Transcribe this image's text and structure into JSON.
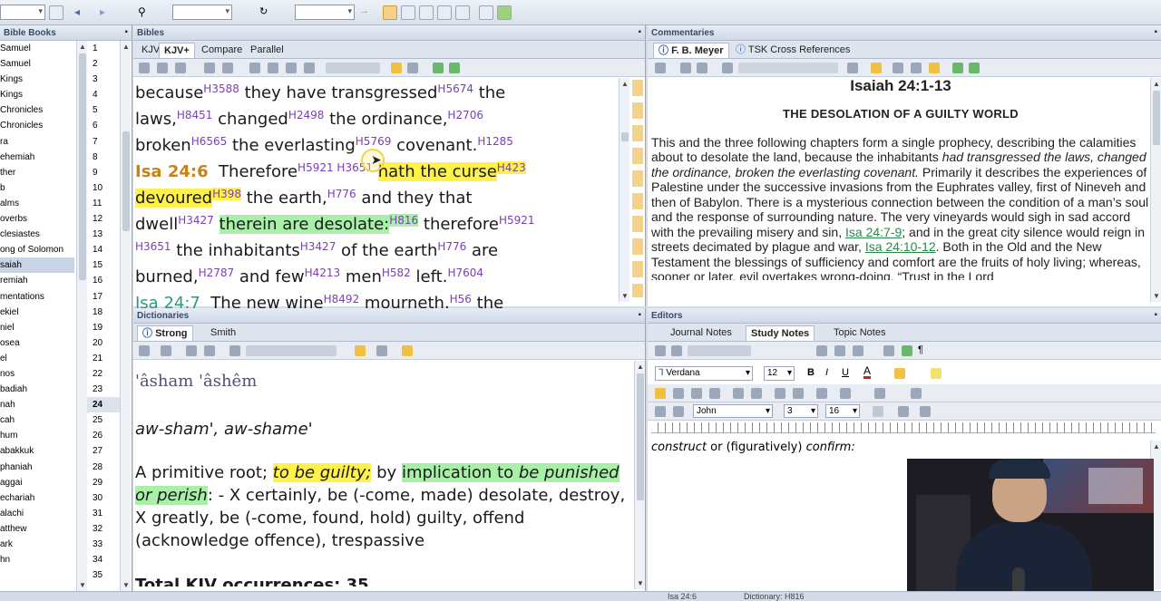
{
  "books_panel": {
    "title": "Bible Books",
    "books": [
      "Samuel",
      "Samuel",
      "Kings",
      "Kings",
      "Chronicles",
      "Chronicles",
      "ra",
      "ehemiah",
      "ther",
      "b",
      "alms",
      "overbs",
      "clesiastes",
      "ong of Solomon",
      "saiah",
      "remiah",
      "mentations",
      "ekiel",
      "niel",
      "osea",
      "el",
      "nos",
      "badiah",
      "nah",
      "cah",
      "hum",
      "abakkuk",
      "phaniah",
      "aggai",
      "echariah",
      "alachi",
      "atthew",
      "ark",
      "hn"
    ],
    "selected_book_index": 14,
    "chapters": [
      "1",
      "2",
      "3",
      "4",
      "5",
      "6",
      "7",
      "8",
      "9",
      "10",
      "11",
      "12",
      "13",
      "14",
      "15",
      "16",
      "17",
      "18",
      "19",
      "20",
      "21",
      "22",
      "23",
      "24",
      "25",
      "26",
      "27",
      "28",
      "29",
      "30",
      "31",
      "32",
      "33",
      "34",
      "35"
    ],
    "selected_chapter_index": 23
  },
  "bibles_panel": {
    "title": "Bibles",
    "tabs": [
      "KJV",
      "KJV+",
      "Compare",
      "Parallel"
    ],
    "active_tab": "KJV+",
    "lines": [
      [
        {
          "t": "because"
        },
        {
          "s": "H3588"
        },
        {
          "t": " they have transgressed"
        },
        {
          "s": "H5674"
        },
        {
          "t": " the"
        }
      ],
      [
        {
          "t": "laws,"
        },
        {
          "s": "H8451"
        },
        {
          "t": " changed"
        },
        {
          "s": "H2498"
        },
        {
          "t": " the ordinance,"
        },
        {
          "s": "H2706"
        }
      ],
      [
        {
          "t": "broken"
        },
        {
          "s": "H6565"
        },
        {
          "t": " the everlasting"
        },
        {
          "s": "H5769"
        },
        {
          "t": " covenant."
        },
        {
          "s": "H1285"
        }
      ],
      [
        {
          "v": "Isa 24:6"
        },
        {
          "t": "  Therefore"
        },
        {
          "s": "H5921"
        },
        {
          "s": " H3651"
        },
        {
          "t": " "
        },
        {
          "y": "hath the curse"
        },
        {
          "sy": "H423"
        }
      ],
      [
        {
          "y": "devoured"
        },
        {
          "sy": "H398"
        },
        {
          "t": " the earth,"
        },
        {
          "s": "H776"
        },
        {
          "t": " and they that"
        }
      ],
      [
        {
          "t": "dwell"
        },
        {
          "s": "H3427"
        },
        {
          "t": " "
        },
        {
          "g": "therein are desolate:"
        },
        {
          "sg": "H816"
        },
        {
          "t": " therefore"
        },
        {
          "s": "H5921"
        }
      ],
      [
        {
          "s": "H3651"
        },
        {
          "t": " the inhabitants"
        },
        {
          "s": "H3427"
        },
        {
          "t": " of the earth"
        },
        {
          "s": "H776"
        },
        {
          "t": " are"
        }
      ],
      [
        {
          "t": "burned,"
        },
        {
          "s": "H2787"
        },
        {
          "t": " and few"
        },
        {
          "s": "H4213"
        },
        {
          "t": " men"
        },
        {
          "s": "H582"
        },
        {
          "t": " left."
        },
        {
          "s": "H7604"
        }
      ],
      [
        {
          "v2": "Isa 24:7"
        },
        {
          "t": "  The new wine"
        },
        {
          "s": "H8492"
        },
        {
          "t": " mourneth,"
        },
        {
          "s": "H56"
        },
        {
          "t": " the"
        }
      ]
    ]
  },
  "commentaries_panel": {
    "title": "Commentaries",
    "tabs": [
      "F. B. Meyer",
      "TSK Cross References"
    ],
    "heading": "Isaiah 24:1-13",
    "subheading": "THE DESOLATION OF A GUILTY WORLD",
    "body_pre": "This and the three following chapters form a single prophecy, describing the calamities about to desolate the land, because the inhabitants ",
    "body_italic": "had transgressed the laws, changed the ordinance, broken the everlasting covenant.",
    "body_mid": " Primarily it describes the experiences of Palestine under the successive invasions from the Euphrates valley, first of Nineveh and then of Babylon. There is a mysterious connection between the condition of a man’s soul and the response of surrounding nature. The very vineyards would sigh in sad accord with the prevailing misery and sin, ",
    "link1": "Isa 24:7-9",
    "body_mid2": "; and in the great city silence would reign in streets decimated by plague and war, ",
    "link2": "Isa 24:10-12",
    "body_end": ". Both in the Old and the New Testament the blessings of sufficiency and comfort are the fruits of holy living; whereas, sooner or later, evil overtakes wrong-doing. “Trust in the Lord"
  },
  "dictionaries_panel": {
    "title": "Dictionaries",
    "tabs": [
      "Strong",
      "Smith"
    ],
    "active_tab": "Strong",
    "headword": "'âsham    'âshêm",
    "pronunciation": "aw-sham', aw-shame'",
    "def_1": "A primitive root; ",
    "def_hl1": "to be guilty;",
    "def_2": " by ",
    "def_hl2": "implication to ",
    "def_hl3": "be punished or perish",
    "def_3": ": -  X certainly, be (-come, made) desolate, destroy, X greatly, be (-come, found, hold) guilty, offend (acknowledge offence), trespassive",
    "occurrences": "Total KJV occurrences: 35"
  },
  "editors_panel": {
    "title": "Editors",
    "tabs": [
      "Journal Notes",
      "Study Notes",
      "Topic Notes"
    ],
    "active_tab": "Study Notes",
    "font_name": "Verdana",
    "font_size": "12",
    "book_select": "John",
    "chapter_select": "3",
    "verse_select": "16",
    "content_pre": "construct",
    "content_mid": " or (figuratively) ",
    "content_end": "confirm:"
  },
  "status_bar": {
    "ref": "Isa 24:6",
    "dict": "Dictionary: H816"
  }
}
